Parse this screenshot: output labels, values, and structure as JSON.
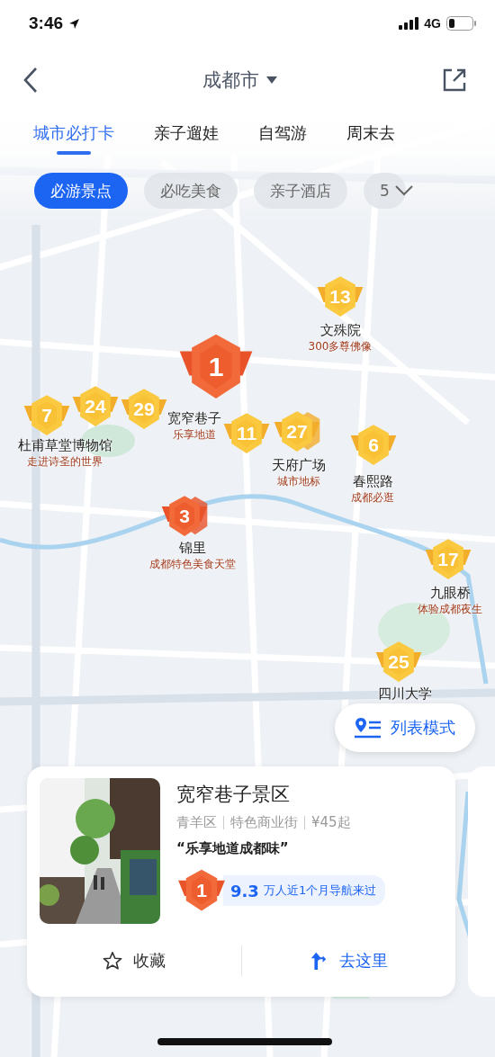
{
  "status_bar": {
    "time": "3:46",
    "network": "4G"
  },
  "nav": {
    "city": "成都市"
  },
  "tabs": [
    {
      "label": "城市必打卡",
      "selected": true
    },
    {
      "label": "亲子遛娃",
      "selected": false
    },
    {
      "label": "自驾游",
      "selected": false
    },
    {
      "label": "周末去",
      "selected": false
    }
  ],
  "chips": [
    {
      "label": "必游景点",
      "selected": true
    },
    {
      "label": "必吃美食",
      "selected": false
    },
    {
      "label": "亲子酒店",
      "selected": false
    },
    {
      "label": "5",
      "selected": false
    }
  ],
  "markers": [
    {
      "rank": "13",
      "kind": "regular",
      "title": "文殊院",
      "subtitle": "300多尊佛像"
    },
    {
      "rank": "1",
      "kind": "top",
      "title": "宽窄巷子",
      "subtitle": "乐享地道"
    },
    {
      "rank": "7",
      "kind": "regular",
      "title": "杜甫草堂博物馆",
      "subtitle": "走进诗圣的世界"
    },
    {
      "rank": "24",
      "kind": "regular"
    },
    {
      "rank": "29",
      "kind": "regular"
    },
    {
      "rank": "11",
      "kind": "regular"
    },
    {
      "rank": "27",
      "kind": "regular",
      "title": "天府广场",
      "subtitle": "城市地标"
    },
    {
      "rank": "6",
      "kind": "regular",
      "title": "春熙路",
      "subtitle": "成都必逛"
    },
    {
      "rank": "3",
      "kind": "top",
      "title": "锦里",
      "subtitle": "成都特色美食天堂"
    },
    {
      "rank": "17",
      "kind": "regular",
      "title": "九眼桥",
      "subtitle": "体验成都夜生"
    },
    {
      "rank": "25",
      "kind": "regular",
      "title": "四川大学"
    }
  ],
  "list_mode_button": {
    "label": "列表模式"
  },
  "card": {
    "title": "宽窄巷子景区",
    "meta": [
      "青羊区",
      "特色商业街",
      "¥45起"
    ],
    "quote": "“乐享地道成都味”",
    "rank": "1",
    "visits_number": "9.3",
    "visits_text": "万人近1个月导航来过",
    "actions": [
      {
        "label": "收藏",
        "kind": "favorite"
      },
      {
        "label": "去这里",
        "kind": "navigate"
      }
    ]
  }
}
